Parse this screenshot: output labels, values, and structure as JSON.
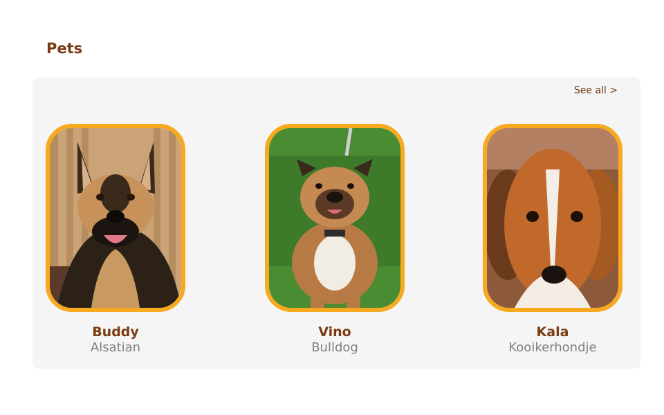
{
  "section": {
    "title": "Pets"
  },
  "panel": {
    "see_all_label": "See all >"
  },
  "pets": [
    {
      "name": "Buddy",
      "breed": "Alsatian"
    },
    {
      "name": "Vino",
      "breed": "Bulldog"
    },
    {
      "name": "Kala",
      "breed": "Kooikerhondje"
    }
  ],
  "colors": {
    "accent_border": "#f7a91f",
    "title_brown": "#7a3b12",
    "panel_bg": "#f5f5f5",
    "breed_gray": "#808080"
  }
}
